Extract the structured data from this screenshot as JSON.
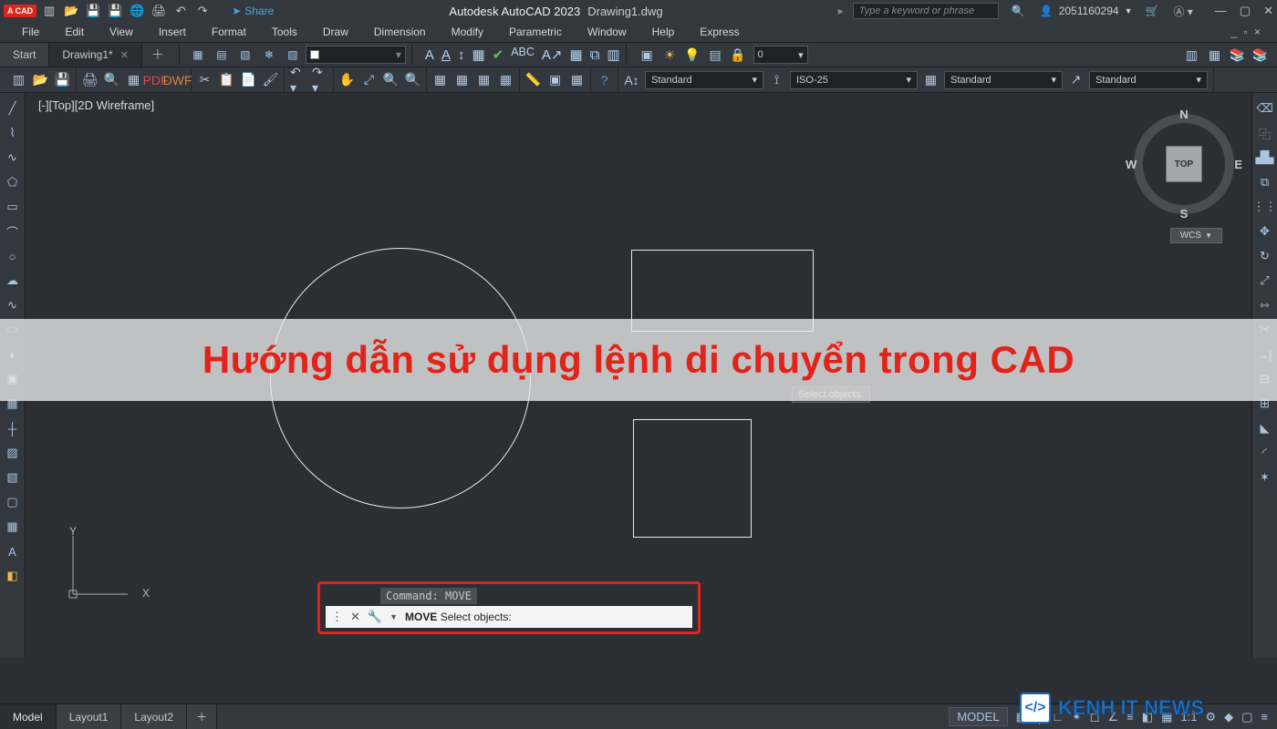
{
  "app": {
    "name": "Autodesk AutoCAD 2023",
    "file": "Drawing1.dwg",
    "badge": "A CAD"
  },
  "share": "Share",
  "search_placeholder": "Type a keyword or phrase",
  "user": "2051160294",
  "menubar": [
    "File",
    "Edit",
    "View",
    "Insert",
    "Format",
    "Tools",
    "Draw",
    "Dimension",
    "Modify",
    "Parametric",
    "Window",
    "Help",
    "Express"
  ],
  "file_tabs": {
    "start": "Start",
    "active": "Drawing1*"
  },
  "layer_value": "0",
  "styles": {
    "text": "Standard",
    "dim": "ISO-25",
    "table": "Standard",
    "ml": "Standard"
  },
  "viewport": {
    "label": "[-][Top][2D Wireframe]",
    "wcs": "WCS",
    "top": "TOP"
  },
  "compass": {
    "n": "N",
    "s": "S",
    "e": "E",
    "w": "W"
  },
  "ucs": {
    "x": "X",
    "y": "Y"
  },
  "tooltip": "Select objects:",
  "command": {
    "hint": "Command: MOVE",
    "line": "MOVE Select objects:",
    "cmd": "MOVE",
    "rest": " Select objects:"
  },
  "model_tabs": [
    "Model",
    "Layout1",
    "Layout2"
  ],
  "status_model": "MODEL",
  "status_ratio": "1:1",
  "overlay": "Hướng dẫn sử dụng lệnh di chuyển trong CAD",
  "watermark": "KENH IT NEWS"
}
